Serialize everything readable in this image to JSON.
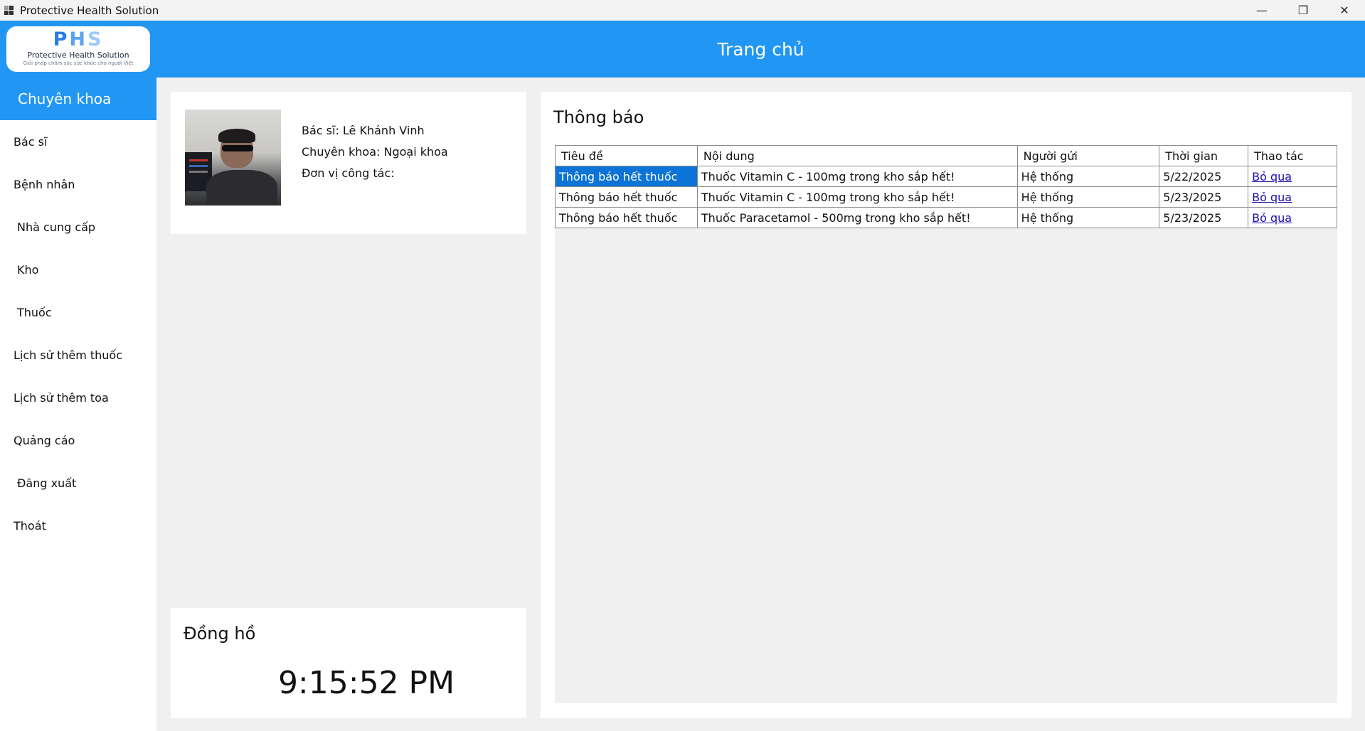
{
  "window": {
    "title": "Protective Health Solution",
    "minimize": "—",
    "restore": "❐",
    "close": "✕"
  },
  "logo": {
    "letters": [
      "P",
      "H",
      "S"
    ],
    "name": "Protective Health Solution",
    "tagline": "Giải pháp chăm sóc sức khỏe cho người Việt"
  },
  "header": {
    "title": "Trang chủ"
  },
  "sidebar": {
    "active": "Chuyên khoa",
    "items": [
      {
        "label": "Bác sĩ"
      },
      {
        "label": "Bệnh nhân"
      },
      {
        "label": "Nhà cung cấp"
      },
      {
        "label": "Kho"
      },
      {
        "label": "Thuốc"
      },
      {
        "label": "Lịch sử thêm thuốc"
      },
      {
        "label": "Lịch sử thêm toa"
      },
      {
        "label": "Quảng cáo"
      },
      {
        "label": "Đăng xuất"
      },
      {
        "label": "Thoát"
      }
    ]
  },
  "profile": {
    "doctor": "Bác sĩ: Lê Khánh Vinh",
    "specialty": "Chuyên khoa: Ngoại khoa",
    "unit": "Đơn vị công tác:"
  },
  "clock": {
    "title": "Đồng hồ",
    "time": "9:15:52 PM"
  },
  "notifications": {
    "title": "Thông báo",
    "columns": [
      "Tiêu đề",
      "Nội dung",
      "Người gửi",
      "Thời gian",
      "Thao tác"
    ],
    "rows": [
      {
        "title": "Thông báo hết thuốc",
        "content": "Thuốc Vitamin C - 100mg trong kho sắp hết!",
        "sender": "Hệ thống",
        "time": "5/22/2025",
        "action": "Bỏ qua"
      },
      {
        "title": "Thông báo hết thuốc",
        "content": "Thuốc Vitamin C - 100mg trong kho sắp hết!",
        "sender": "Hệ thống",
        "time": "5/23/2025",
        "action": "Bỏ qua"
      },
      {
        "title": "Thông báo hết thuốc",
        "content": "Thuốc Paracetamol - 500mg trong kho sắp hết!",
        "sender": "Hệ thống",
        "time": "5/23/2025",
        "action": "Bỏ qua"
      }
    ]
  }
}
